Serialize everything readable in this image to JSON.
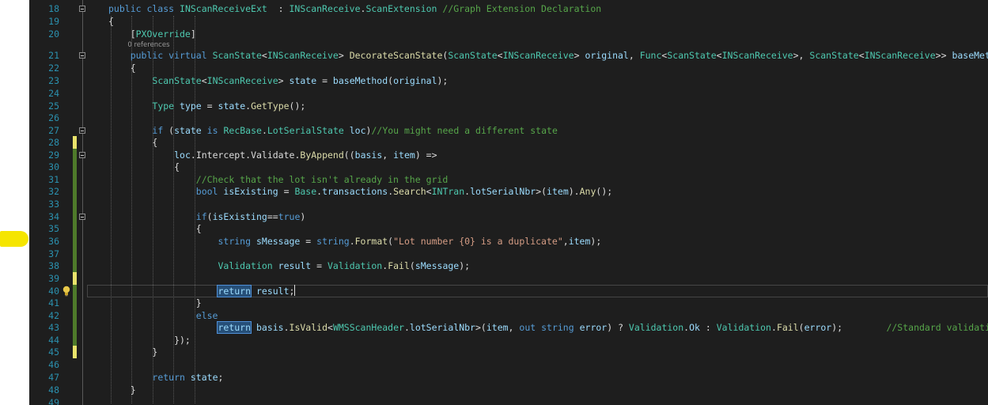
{
  "colors": {
    "editor_bg": "#1e1e1e",
    "line_number": "#2b91af",
    "keyword": "#569cd6",
    "type": "#4ec9b0",
    "method": "#dcdcaa",
    "parameter": "#9cdcfe",
    "string": "#d69d85",
    "comment": "#57a64a",
    "change_bar_saved": "#4e7a2a",
    "change_bar_unsaved": "#e9e36b",
    "highlight": "#f5e500"
  },
  "editor": {
    "codelens": {
      "references": "0 references"
    },
    "lightbulb_icon": "lightbulb-icon",
    "lines": [
      {
        "n": "18",
        "t": [
          [
            "kw",
            "public class "
          ],
          [
            "ty",
            "INScanReceiveExt"
          ],
          [
            "",
            "  : "
          ],
          [
            "ty",
            "INScanReceive"
          ],
          [
            "",
            "."
          ],
          [
            "ty",
            "ScanExtension"
          ],
          [
            "",
            " "
          ],
          [
            "cm",
            "//Graph Extension Declaration"
          ]
        ]
      },
      {
        "n": "19",
        "t": [
          [
            "",
            "{"
          ]
        ]
      },
      {
        "n": "20",
        "t": [
          [
            "",
            "    ["
          ],
          [
            "ty",
            "PXOverride"
          ],
          [
            "",
            "]"
          ]
        ]
      },
      {
        "n": "21",
        "t": [
          [
            "kw",
            "    public virtual "
          ],
          [
            "ty",
            "ScanState"
          ],
          [
            "",
            "<"
          ],
          [
            "ty",
            "INScanReceive"
          ],
          [
            "",
            "> "
          ],
          [
            "mt",
            "DecorateScanState"
          ],
          [
            "",
            "("
          ],
          [
            "ty",
            "ScanState"
          ],
          [
            "",
            "<"
          ],
          [
            "ty",
            "INScanReceive"
          ],
          [
            "",
            "> "
          ],
          [
            "pm",
            "original"
          ],
          [
            "",
            ", "
          ],
          [
            "ty",
            "Func"
          ],
          [
            "",
            "<"
          ],
          [
            "ty",
            "ScanState"
          ],
          [
            "",
            "<"
          ],
          [
            "ty",
            "INScanReceive"
          ],
          [
            "",
            ">, "
          ],
          [
            "ty",
            "ScanState"
          ],
          [
            "",
            "<"
          ],
          [
            "ty",
            "INScanReceive"
          ],
          [
            "",
            ">> "
          ],
          [
            "pm",
            "baseMethod"
          ],
          [
            "",
            ")"
          ]
        ]
      },
      {
        "n": "22",
        "t": [
          [
            "",
            "    {"
          ]
        ]
      },
      {
        "n": "23",
        "t": [
          [
            "",
            "        "
          ],
          [
            "ty",
            "ScanState"
          ],
          [
            "",
            "<"
          ],
          [
            "ty",
            "INScanReceive"
          ],
          [
            "",
            "> "
          ],
          [
            "pm",
            "state"
          ],
          [
            "",
            " = "
          ],
          [
            "pm",
            "baseMethod"
          ],
          [
            "",
            "("
          ],
          [
            "pm",
            "original"
          ],
          [
            "",
            ");"
          ]
        ]
      },
      {
        "n": "24",
        "t": []
      },
      {
        "n": "25",
        "t": [
          [
            "",
            "        "
          ],
          [
            "ty",
            "Type"
          ],
          [
            "",
            " "
          ],
          [
            "pm",
            "type"
          ],
          [
            "",
            " = "
          ],
          [
            "pm",
            "state"
          ],
          [
            "",
            "."
          ],
          [
            "mt",
            "GetType"
          ],
          [
            "",
            "();"
          ]
        ]
      },
      {
        "n": "26",
        "t": []
      },
      {
        "n": "27",
        "t": [
          [
            "",
            "        "
          ],
          [
            "kw",
            "if"
          ],
          [
            "",
            " ("
          ],
          [
            "pm",
            "state"
          ],
          [
            "",
            " "
          ],
          [
            "kw",
            "is"
          ],
          [
            "",
            " "
          ],
          [
            "ty",
            "RecBase"
          ],
          [
            "",
            "."
          ],
          [
            "ty",
            "LotSerialState"
          ],
          [
            "",
            " "
          ],
          [
            "pm",
            "loc"
          ],
          [
            "",
            ")"
          ],
          [
            "cm",
            "//You might need a different state"
          ]
        ]
      },
      {
        "n": "28",
        "t": [
          [
            "",
            "        {"
          ]
        ]
      },
      {
        "n": "29",
        "t": [
          [
            "",
            "            "
          ],
          [
            "pm",
            "loc"
          ],
          [
            "",
            "."
          ],
          [
            "",
            "Intercept"
          ],
          [
            "",
            "."
          ],
          [
            "",
            "Validate"
          ],
          [
            "",
            "."
          ],
          [
            "mt",
            "ByAppend"
          ],
          [
            "",
            "(("
          ],
          [
            "pm",
            "basis"
          ],
          [
            "",
            ", "
          ],
          [
            "pm",
            "item"
          ],
          [
            "",
            ") =>"
          ]
        ]
      },
      {
        "n": "30",
        "t": [
          [
            "",
            "            {"
          ]
        ]
      },
      {
        "n": "31",
        "t": [
          [
            "",
            "                "
          ],
          [
            "cm",
            "//Check that the lot isn't already in the grid"
          ]
        ]
      },
      {
        "n": "32",
        "t": [
          [
            "",
            "                "
          ],
          [
            "kw",
            "bool"
          ],
          [
            "",
            " "
          ],
          [
            "pm",
            "isExisting"
          ],
          [
            "",
            " = "
          ],
          [
            "ty",
            "Base"
          ],
          [
            "",
            "."
          ],
          [
            "pm",
            "transactions"
          ],
          [
            "",
            "."
          ],
          [
            "mt",
            "Search"
          ],
          [
            "",
            "<"
          ],
          [
            "ty",
            "INTran"
          ],
          [
            "",
            "."
          ],
          [
            "pm",
            "lotSerialNbr"
          ],
          [
            "",
            ">("
          ],
          [
            "pm",
            "item"
          ],
          [
            "",
            ")."
          ],
          [
            "mt",
            "Any"
          ],
          [
            "",
            "();"
          ]
        ]
      },
      {
        "n": "33",
        "t": []
      },
      {
        "n": "34",
        "t": [
          [
            "",
            "                "
          ],
          [
            "kw",
            "if"
          ],
          [
            "",
            "("
          ],
          [
            "pm",
            "isExisting"
          ],
          [
            "",
            "=="
          ],
          [
            "kw",
            "true"
          ],
          [
            "",
            ")"
          ]
        ]
      },
      {
        "n": "35",
        "t": [
          [
            "",
            "                {"
          ]
        ]
      },
      {
        "n": "36",
        "t": [
          [
            "",
            "                    "
          ],
          [
            "kw",
            "string"
          ],
          [
            "",
            " "
          ],
          [
            "pm",
            "sMessage"
          ],
          [
            "",
            " = "
          ],
          [
            "kw",
            "string"
          ],
          [
            "",
            "."
          ],
          [
            "mt",
            "Format"
          ],
          [
            "",
            "("
          ],
          [
            "st",
            "\"Lot number {0} is a duplicate\""
          ],
          [
            "",
            ","
          ],
          [
            "pm",
            "item"
          ],
          [
            "",
            ");"
          ]
        ]
      },
      {
        "n": "37",
        "t": []
      },
      {
        "n": "38",
        "t": [
          [
            "",
            "                    "
          ],
          [
            "ty",
            "Validation"
          ],
          [
            "",
            " "
          ],
          [
            "pm",
            "result"
          ],
          [
            "",
            " = "
          ],
          [
            "ty",
            "Validation"
          ],
          [
            "",
            "."
          ],
          [
            "mt",
            "Fail"
          ],
          [
            "",
            "("
          ],
          [
            "pm",
            "sMessage"
          ],
          [
            "",
            ");"
          ]
        ]
      },
      {
        "n": "39",
        "t": []
      },
      {
        "n": "40",
        "t": [
          [
            "",
            "                    "
          ],
          [
            "box",
            "return"
          ],
          [
            "",
            " "
          ],
          [
            "pm",
            "result"
          ],
          [
            "",
            ";"
          ]
        ]
      },
      {
        "n": "41",
        "t": [
          [
            "",
            "                }"
          ]
        ]
      },
      {
        "n": "42",
        "t": [
          [
            "",
            "                "
          ],
          [
            "kw",
            "else"
          ]
        ]
      },
      {
        "n": "43",
        "t": [
          [
            "",
            "                    "
          ],
          [
            "box",
            "return"
          ],
          [
            "",
            " "
          ],
          [
            "pm",
            "basis"
          ],
          [
            "",
            "."
          ],
          [
            "mt",
            "IsValid"
          ],
          [
            "",
            "<"
          ],
          [
            "ty",
            "WMSScanHeader"
          ],
          [
            "",
            "."
          ],
          [
            "pm",
            "lotSerialNbr"
          ],
          [
            "",
            ">("
          ],
          [
            "pm",
            "item"
          ],
          [
            "",
            ", "
          ],
          [
            "kw",
            "out string"
          ],
          [
            "",
            " "
          ],
          [
            "pm",
            "error"
          ],
          [
            "",
            ") ? "
          ],
          [
            "ty",
            "Validation"
          ],
          [
            "",
            "."
          ],
          [
            "pm",
            "Ok"
          ],
          [
            "",
            " : "
          ],
          [
            "ty",
            "Validation"
          ],
          [
            "",
            "."
          ],
          [
            "mt",
            "Fail"
          ],
          [
            "",
            "("
          ],
          [
            "pm",
            "error"
          ],
          [
            "",
            ");        "
          ],
          [
            "cm",
            "//Standard validation"
          ]
        ]
      },
      {
        "n": "44",
        "t": [
          [
            "",
            "            });"
          ]
        ]
      },
      {
        "n": "45",
        "t": [
          [
            "",
            "        }"
          ]
        ]
      },
      {
        "n": "46",
        "t": []
      },
      {
        "n": "47",
        "t": [
          [
            "",
            "        "
          ],
          [
            "kw",
            "return"
          ],
          [
            "",
            " "
          ],
          [
            "pm",
            "state"
          ],
          [
            "",
            ";"
          ]
        ]
      },
      {
        "n": "48",
        "t": [
          [
            "",
            "    }"
          ]
        ]
      },
      {
        "n": "49",
        "t": []
      }
    ]
  }
}
